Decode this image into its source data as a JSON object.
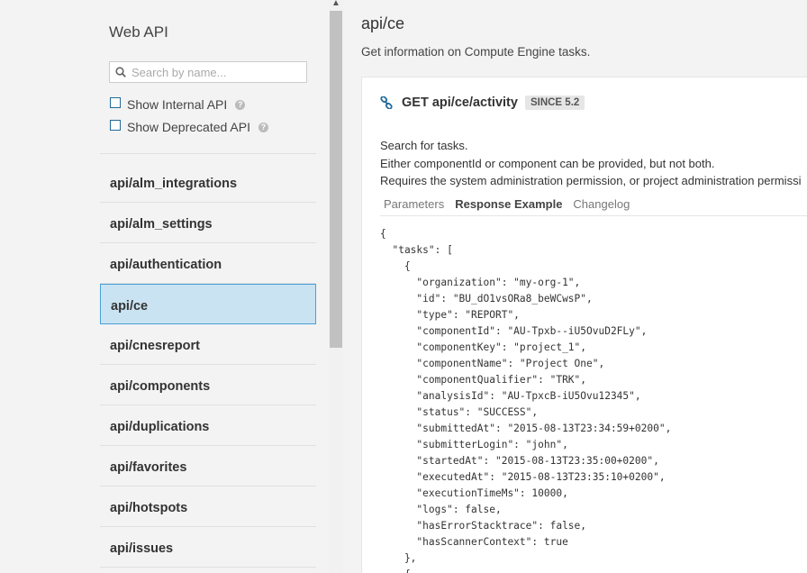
{
  "sidebar": {
    "title": "Web API",
    "search": {
      "placeholder": "Search by name...",
      "value": ""
    },
    "options": [
      {
        "label": "Show Internal API",
        "checked": false
      },
      {
        "label": "Show Deprecated API",
        "checked": false
      }
    ],
    "items": [
      {
        "label": "api/alm_integrations"
      },
      {
        "label": "api/alm_settings"
      },
      {
        "label": "api/authentication"
      },
      {
        "label": "api/ce",
        "active": true
      },
      {
        "label": "api/cnesreport"
      },
      {
        "label": "api/components"
      },
      {
        "label": "api/duplications"
      },
      {
        "label": "api/favorites"
      },
      {
        "label": "api/hotspots"
      },
      {
        "label": "api/issues"
      }
    ]
  },
  "main": {
    "title": "api/ce",
    "description": "Get information on Compute Engine tasks.",
    "endpoint": {
      "method_path": "GET api/ce/activity",
      "since": "SINCE 5.2",
      "desc_lines": [
        "Search for tasks.",
        "Either componentId or component can be provided, but not both.",
        "Requires the system administration permission, or project administration permissi"
      ],
      "tabs": [
        "Parameters",
        "Response Example",
        "Changelog"
      ],
      "active_tab": "Response Example",
      "response_example": "{\n  \"tasks\": [\n    {\n      \"organization\": \"my-org-1\",\n      \"id\": \"BU_dO1vsORa8_beWCwsP\",\n      \"type\": \"REPORT\",\n      \"componentId\": \"AU-Tpxb--iU5OvuD2FLy\",\n      \"componentKey\": \"project_1\",\n      \"componentName\": \"Project One\",\n      \"componentQualifier\": \"TRK\",\n      \"analysisId\": \"AU-TpxcB-iU5Ovu12345\",\n      \"status\": \"SUCCESS\",\n      \"submittedAt\": \"2015-08-13T23:34:59+0200\",\n      \"submitterLogin\": \"john\",\n      \"startedAt\": \"2015-08-13T23:35:00+0200\",\n      \"executedAt\": \"2015-08-13T23:35:10+0200\",\n      \"executionTimeMs\": 10000,\n      \"logs\": false,\n      \"hasErrorStacktrace\": false,\n      \"hasScannerContext\": true\n    },\n    {"
    }
  }
}
